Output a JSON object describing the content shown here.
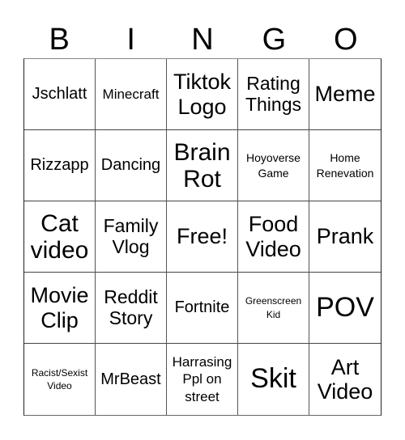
{
  "card": {
    "header_letters": [
      "B",
      "I",
      "N",
      "G",
      "O"
    ],
    "cells": [
      {
        "text": "Jschlatt",
        "size": "s-lg"
      },
      {
        "text": "Minecraft",
        "size": "s-md"
      },
      {
        "text": "Tiktok Logo",
        "size": "s-2xl"
      },
      {
        "text": "Rating Things",
        "size": "s-xl"
      },
      {
        "text": "Meme",
        "size": "s-2xl"
      },
      {
        "text": "Rizzapp",
        "size": "s-lg"
      },
      {
        "text": "Dancing",
        "size": "s-lg"
      },
      {
        "text": "Brain Rot",
        "size": "s-3xl"
      },
      {
        "text": "Hoyoverse Game",
        "size": "s-sm"
      },
      {
        "text": "Home Renevation",
        "size": "s-sm"
      },
      {
        "text": "Cat video",
        "size": "s-3xl"
      },
      {
        "text": "Family Vlog",
        "size": "s-xl"
      },
      {
        "text": "Free!",
        "size": "s-2xl"
      },
      {
        "text": "Food Video",
        "size": "s-2xl"
      },
      {
        "text": "Prank",
        "size": "s-2xl"
      },
      {
        "text": "Movie Clip",
        "size": "s-2xl"
      },
      {
        "text": "Reddit Story",
        "size": "s-xl"
      },
      {
        "text": "Fortnite",
        "size": "s-lg"
      },
      {
        "text": "Greenscreen Kid",
        "size": "s-xs"
      },
      {
        "text": "POV",
        "size": "s-4xl"
      },
      {
        "text": "Racist/Sexist Video",
        "size": "s-xs"
      },
      {
        "text": "MrBeast",
        "size": "s-lg"
      },
      {
        "text": "Harrasing Ppl on street",
        "size": "s-md"
      },
      {
        "text": "Skit",
        "size": "s-4xl"
      },
      {
        "text": "Art Video",
        "size": "s-2xl"
      }
    ]
  }
}
